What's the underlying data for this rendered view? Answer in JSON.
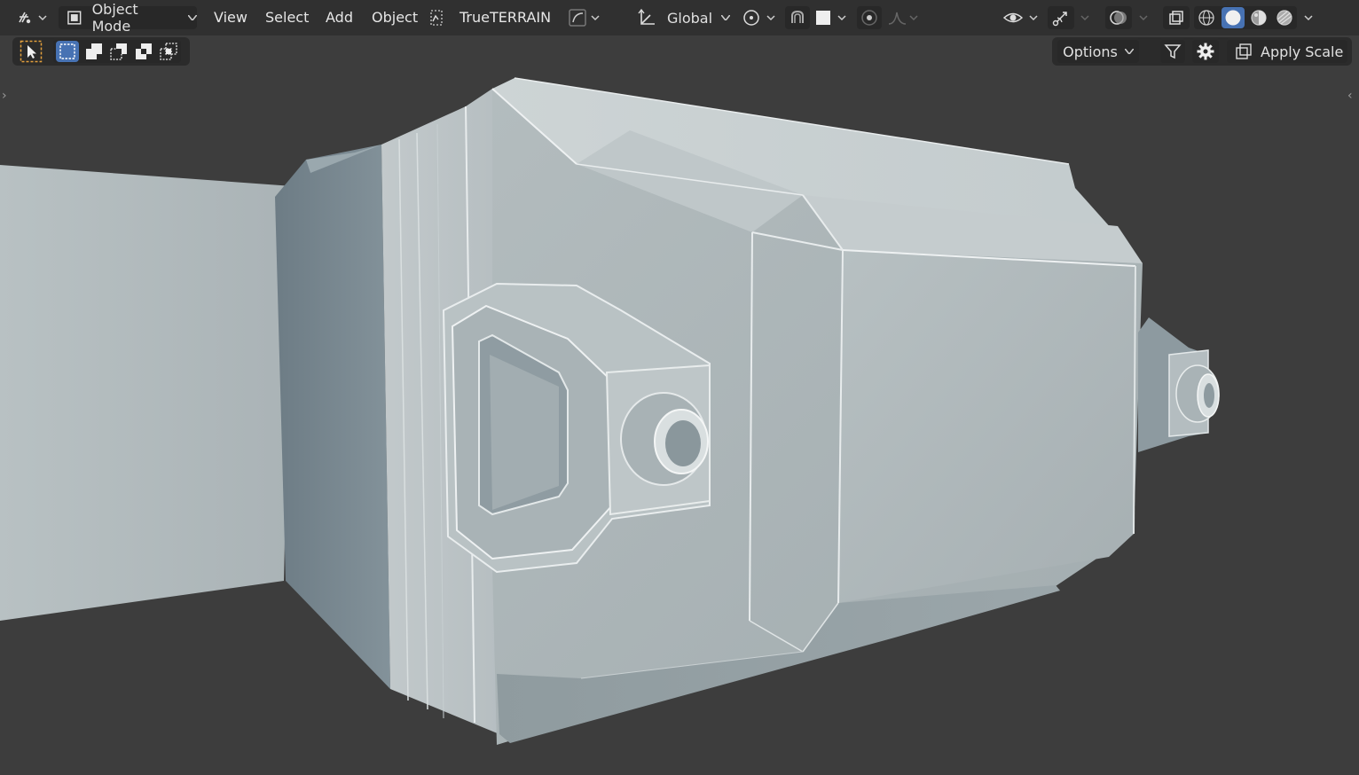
{
  "header": {
    "mode_label": "Object Mode",
    "menus": [
      "View",
      "Select",
      "Add",
      "Object"
    ],
    "addon_label": "TrueTERRAIN",
    "orientation_label": "Global"
  },
  "tool_header": {
    "options_label": "Options",
    "apply_scale_label": "Apply Scale"
  },
  "icons": {
    "editor_type": "editor-type-icon",
    "object_mode": "object-mode-icon",
    "terrain": "terrain-icon",
    "curve": "curve-icon",
    "transform_orientation": "transform-orientation-icon",
    "pivot": "pivot-icon",
    "snap": "snap-icon",
    "snap_target": "snap-target-icon",
    "proportional": "proportional-edit-icon",
    "falloff": "falloff-icon",
    "visibility": "visibility-icon",
    "gizmo": "gizmo-icon",
    "overlay": "overlay-icon",
    "xray": "xray-icon",
    "shading": [
      "wireframe-shading-icon",
      "solid-shading-icon",
      "material-shading-icon",
      "rendered-shading-icon"
    ],
    "select_tool": "select-tool-icon",
    "select_modes": [
      "select-new-icon",
      "select-extend-icon",
      "select-subtract-icon",
      "select-invert-icon",
      "select-intersect-icon"
    ],
    "filter": "filter-icon",
    "settings": "gear-icon",
    "apply": "apply-scale-icon"
  },
  "colors": {
    "header_bg": "#303030",
    "viewport_bg": "#3d3d3d",
    "accent": "#4772b3",
    "select_tool_outline": "#e4a03c"
  }
}
